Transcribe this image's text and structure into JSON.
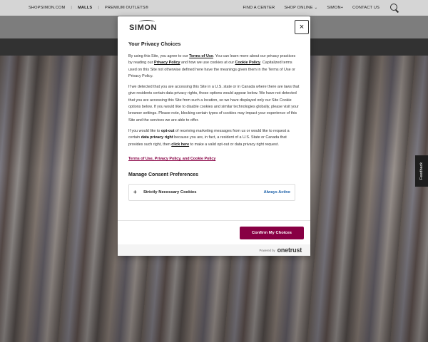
{
  "topnav": {
    "shopsimon": "SHOPSIMON.COM",
    "sep": "|",
    "malls": "MALLS",
    "premium_outlets": "PREMIUM OUTLETS®",
    "find_center": "FIND A CENTER",
    "shop_online": "SHOP ONLINE",
    "simon_plus": "SIMON+",
    "contact_us": "CONTACT US"
  },
  "feedback": "Feedback",
  "modal": {
    "logo": "SIMON",
    "close": "×",
    "title": "Your Privacy Choices",
    "p1": [
      "By using this Site, you agree to our ",
      "Terms of Use",
      ". You can learn more about our privacy practices by reading our ",
      "Privacy Policy",
      " and how we use cookies at our ",
      "Cookie Policy",
      ". Capitalized terms used on this Site not otherwise defined here have the meanings given them in the Terms of Use or Privacy Policy."
    ],
    "p2": "If we detected that you are accessing this Site in a U.S. state or in Canada where there are laws that give residents certain data privacy rights, those options would appear below. We have not detected that you are accessing this Site from such a location, so we have displayed only our Site Cookie options below. If you would like to disable cookies and similar technologies globally, please visit your browser settings. Please note, blocking certain types of cookies may impact your experience of this Site and the services we are able to offer.",
    "p3": [
      "If you would like to ",
      "opt-out",
      " of receiving marketing messages from us or would like to request a certain ",
      "data privacy right",
      " because you are, in fact, a resident of a U.S. State or Canada that provides such right, then ",
      "click here",
      " to make a valid opt-out or data privacy right request."
    ],
    "link": "Terms of Use, Privacy Policy, and Cookie Policy",
    "manage_title": "Manage Consent Preferences",
    "consent_plus": "+",
    "consent_label": "Strictly Necessary Cookies",
    "consent_status": "Always Active",
    "confirm": "Confirm My Choices",
    "powered_by": "Powered by",
    "onetrust": "onetrust"
  },
  "colors": {
    "accent": "#880044",
    "always_active": "#1a5fa8"
  }
}
